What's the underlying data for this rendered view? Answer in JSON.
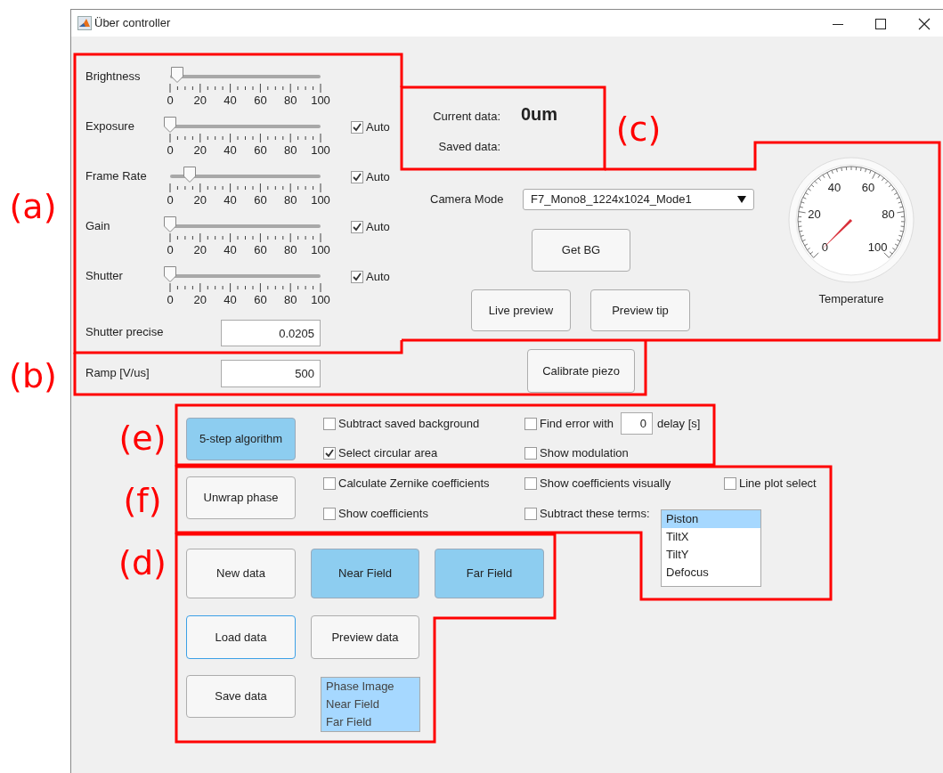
{
  "window": {
    "title": "Über controller"
  },
  "annotation_labels": [
    "(a)",
    "(b)",
    "(c)",
    "(e)",
    "(f)",
    "(d)"
  ],
  "sliders": [
    {
      "label": "Brightness",
      "level": 0.05,
      "tick_labels": [
        "0",
        "20",
        "40",
        "60",
        "80",
        "100"
      ]
    },
    {
      "label": "Exposure",
      "level": 0,
      "tick_labels": [
        "0",
        "20",
        "40",
        "60",
        "80",
        "100"
      ],
      "auto": {
        "label": "Auto",
        "checked": true
      }
    },
    {
      "label": "Frame Rate",
      "level": 0.13,
      "tick_labels": [
        "0",
        "20",
        "40",
        "60",
        "80",
        "100"
      ],
      "auto": {
        "label": "Auto",
        "checked": true
      }
    },
    {
      "label": "Gain",
      "level": 0,
      "tick_labels": [
        "0",
        "20",
        "40",
        "60",
        "80",
        "100"
      ],
      "auto": {
        "label": "Auto",
        "checked": true
      }
    },
    {
      "label": "Shutter",
      "level": 0,
      "tick_labels": [
        "0",
        "20",
        "40",
        "60",
        "80",
        "100"
      ],
      "auto": {
        "label": "Auto",
        "checked": true
      }
    }
  ],
  "shutter_precise": {
    "label": "Shutter precise",
    "value": "0.0205"
  },
  "ramp": {
    "label": "Ramp [V/us]",
    "value": "500"
  },
  "current_data": {
    "label": "Current data:",
    "value": "0um"
  },
  "saved_data": {
    "label": "Saved data:"
  },
  "camera_mode": {
    "label": "Camera Mode",
    "value": "F7_Mono8_1224x1024_Mode1"
  },
  "camera_buttons": [
    {
      "label": "Get BG"
    },
    {
      "label": "Live preview"
    },
    {
      "label": "Preview tip"
    },
    {
      "label": "Calibrate piezo"
    }
  ],
  "gauge": {
    "label": "Temperature",
    "tick_labels": [
      "0",
      "20",
      "40",
      "60",
      "80",
      "100"
    ]
  },
  "algorithm": {
    "button": {
      "label": "5-step algorithm",
      "selected": true
    },
    "options": [
      {
        "label": "Subtract saved background",
        "checked": false
      },
      {
        "label": "Select circular area",
        "checked": true
      },
      {
        "label": "Find error with",
        "checked": false
      },
      {
        "label": "Show modulation",
        "checked": false
      }
    ],
    "delay": {
      "value": "0",
      "unit": "delay [s]"
    }
  },
  "phase": {
    "button": {
      "label": "Unwrap phase",
      "selected": false
    },
    "options": [
      {
        "label": "Calculate Zernike coefficients",
        "checked": false
      },
      {
        "label": "Show coefficients",
        "checked": false
      },
      {
        "label": "Show coefficients visually",
        "checked": false
      },
      {
        "label": "Subtract these terms:",
        "checked": false
      },
      {
        "label": "Line plot select",
        "checked": false
      }
    ],
    "terms": [
      {
        "label": "Piston",
        "selected": true
      },
      {
        "label": "TiltX",
        "selected": false
      },
      {
        "label": "TiltY",
        "selected": false
      },
      {
        "label": "Defocus",
        "selected": false
      }
    ]
  },
  "data_buttons": [
    {
      "label": "New data",
      "selected": false,
      "focused": false
    },
    {
      "label": "Near Field",
      "selected": true,
      "focused": false
    },
    {
      "label": "Far Field",
      "selected": true,
      "focused": false
    },
    {
      "label": "Load data",
      "selected": false,
      "focused": true
    },
    {
      "label": "Preview data",
      "selected": false,
      "focused": false
    },
    {
      "label": "Save data",
      "selected": false,
      "focused": false
    }
  ],
  "data_list": [
    {
      "label": "Phase Image",
      "selected": true
    },
    {
      "label": "Near Field",
      "selected": true
    },
    {
      "label": "Far Field",
      "selected": true
    }
  ]
}
